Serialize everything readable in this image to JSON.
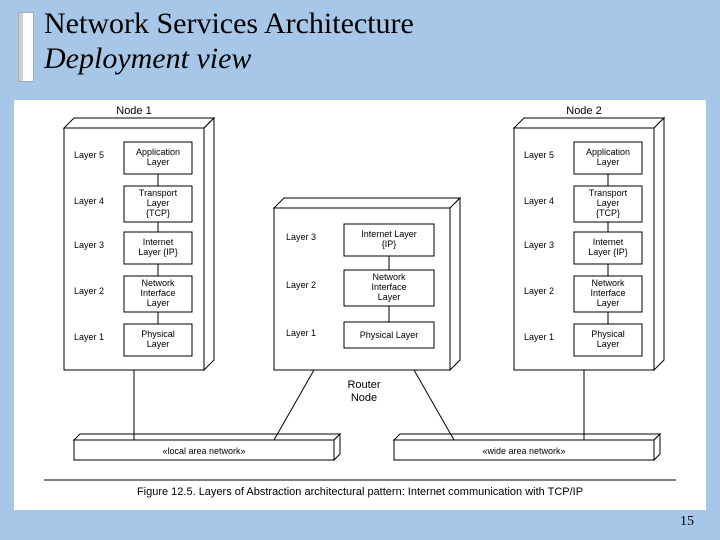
{
  "title_line1": "Network Services Architecture",
  "title_line2": "Deployment view",
  "page_number": "15",
  "caption": "Figure 12.5. Layers of Abstraction architectural pattern: Internet communication with TCP/IP",
  "nodes": {
    "n1": {
      "header": "Node 1",
      "rows": [
        {
          "left": "Layer 5",
          "right": [
            "Application",
            "Layer"
          ]
        },
        {
          "left": "Layer 4",
          "right": [
            "Transport",
            "Layer",
            "{TCP}"
          ]
        },
        {
          "left": "Layer 3",
          "right": [
            "Internet",
            "Layer {IP}"
          ]
        },
        {
          "left": "Layer 2",
          "right": [
            "Network",
            "Interface",
            "Layer"
          ]
        },
        {
          "left": "Layer 1",
          "right": [
            "Physical",
            "Layer"
          ]
        }
      ]
    },
    "router": {
      "header": "Router",
      "sub": "Node",
      "rows": [
        {
          "left": "Layer 3",
          "right": [
            "Internet Layer",
            "{IP}"
          ]
        },
        {
          "left": "Layer 2",
          "right": [
            "Network",
            "Interface",
            "Layer"
          ]
        },
        {
          "left": "Layer 1",
          "right": [
            "Physical Layer"
          ]
        }
      ]
    },
    "n2": {
      "header": "Node 2",
      "rows": [
        {
          "left": "Layer 5",
          "right": [
            "Application",
            "Layer"
          ]
        },
        {
          "left": "Layer 4",
          "right": [
            "Transport",
            "Layer",
            "{TCP}"
          ]
        },
        {
          "left": "Layer 3",
          "right": [
            "Internet",
            "Layer {IP}"
          ]
        },
        {
          "left": "Layer 2",
          "right": [
            "Network",
            "Interface",
            "Layer"
          ]
        },
        {
          "left": "Layer 1",
          "right": [
            "Physical",
            "Layer"
          ]
        }
      ]
    }
  },
  "nets": {
    "lan": "«local area network»",
    "wan": "«wide area network»"
  }
}
